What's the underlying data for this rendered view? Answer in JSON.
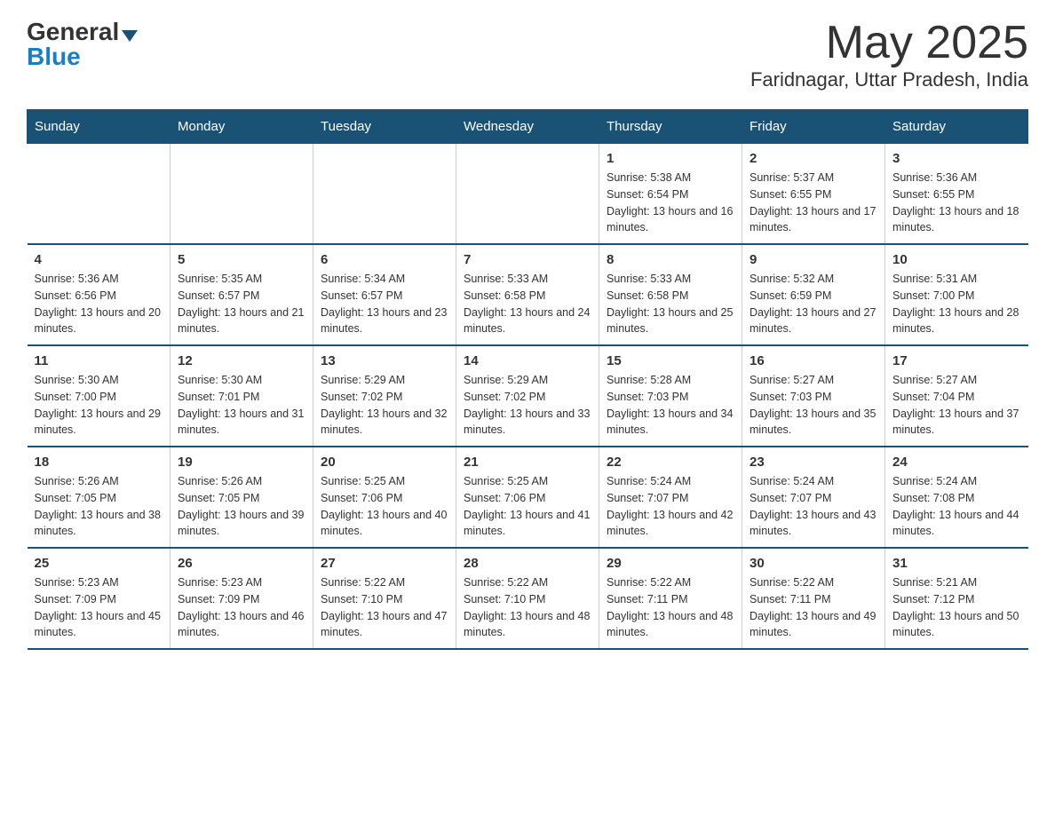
{
  "header": {
    "logo_general": "General",
    "logo_blue": "Blue",
    "month_title": "May 2025",
    "location": "Faridnagar, Uttar Pradesh, India"
  },
  "days_of_week": [
    "Sunday",
    "Monday",
    "Tuesday",
    "Wednesday",
    "Thursday",
    "Friday",
    "Saturday"
  ],
  "weeks": [
    [
      {
        "day": "",
        "info": ""
      },
      {
        "day": "",
        "info": ""
      },
      {
        "day": "",
        "info": ""
      },
      {
        "day": "",
        "info": ""
      },
      {
        "day": "1",
        "info": "Sunrise: 5:38 AM\nSunset: 6:54 PM\nDaylight: 13 hours and 16 minutes."
      },
      {
        "day": "2",
        "info": "Sunrise: 5:37 AM\nSunset: 6:55 PM\nDaylight: 13 hours and 17 minutes."
      },
      {
        "day": "3",
        "info": "Sunrise: 5:36 AM\nSunset: 6:55 PM\nDaylight: 13 hours and 18 minutes."
      }
    ],
    [
      {
        "day": "4",
        "info": "Sunrise: 5:36 AM\nSunset: 6:56 PM\nDaylight: 13 hours and 20 minutes."
      },
      {
        "day": "5",
        "info": "Sunrise: 5:35 AM\nSunset: 6:57 PM\nDaylight: 13 hours and 21 minutes."
      },
      {
        "day": "6",
        "info": "Sunrise: 5:34 AM\nSunset: 6:57 PM\nDaylight: 13 hours and 23 minutes."
      },
      {
        "day": "7",
        "info": "Sunrise: 5:33 AM\nSunset: 6:58 PM\nDaylight: 13 hours and 24 minutes."
      },
      {
        "day": "8",
        "info": "Sunrise: 5:33 AM\nSunset: 6:58 PM\nDaylight: 13 hours and 25 minutes."
      },
      {
        "day": "9",
        "info": "Sunrise: 5:32 AM\nSunset: 6:59 PM\nDaylight: 13 hours and 27 minutes."
      },
      {
        "day": "10",
        "info": "Sunrise: 5:31 AM\nSunset: 7:00 PM\nDaylight: 13 hours and 28 minutes."
      }
    ],
    [
      {
        "day": "11",
        "info": "Sunrise: 5:30 AM\nSunset: 7:00 PM\nDaylight: 13 hours and 29 minutes."
      },
      {
        "day": "12",
        "info": "Sunrise: 5:30 AM\nSunset: 7:01 PM\nDaylight: 13 hours and 31 minutes."
      },
      {
        "day": "13",
        "info": "Sunrise: 5:29 AM\nSunset: 7:02 PM\nDaylight: 13 hours and 32 minutes."
      },
      {
        "day": "14",
        "info": "Sunrise: 5:29 AM\nSunset: 7:02 PM\nDaylight: 13 hours and 33 minutes."
      },
      {
        "day": "15",
        "info": "Sunrise: 5:28 AM\nSunset: 7:03 PM\nDaylight: 13 hours and 34 minutes."
      },
      {
        "day": "16",
        "info": "Sunrise: 5:27 AM\nSunset: 7:03 PM\nDaylight: 13 hours and 35 minutes."
      },
      {
        "day": "17",
        "info": "Sunrise: 5:27 AM\nSunset: 7:04 PM\nDaylight: 13 hours and 37 minutes."
      }
    ],
    [
      {
        "day": "18",
        "info": "Sunrise: 5:26 AM\nSunset: 7:05 PM\nDaylight: 13 hours and 38 minutes."
      },
      {
        "day": "19",
        "info": "Sunrise: 5:26 AM\nSunset: 7:05 PM\nDaylight: 13 hours and 39 minutes."
      },
      {
        "day": "20",
        "info": "Sunrise: 5:25 AM\nSunset: 7:06 PM\nDaylight: 13 hours and 40 minutes."
      },
      {
        "day": "21",
        "info": "Sunrise: 5:25 AM\nSunset: 7:06 PM\nDaylight: 13 hours and 41 minutes."
      },
      {
        "day": "22",
        "info": "Sunrise: 5:24 AM\nSunset: 7:07 PM\nDaylight: 13 hours and 42 minutes."
      },
      {
        "day": "23",
        "info": "Sunrise: 5:24 AM\nSunset: 7:07 PM\nDaylight: 13 hours and 43 minutes."
      },
      {
        "day": "24",
        "info": "Sunrise: 5:24 AM\nSunset: 7:08 PM\nDaylight: 13 hours and 44 minutes."
      }
    ],
    [
      {
        "day": "25",
        "info": "Sunrise: 5:23 AM\nSunset: 7:09 PM\nDaylight: 13 hours and 45 minutes."
      },
      {
        "day": "26",
        "info": "Sunrise: 5:23 AM\nSunset: 7:09 PM\nDaylight: 13 hours and 46 minutes."
      },
      {
        "day": "27",
        "info": "Sunrise: 5:22 AM\nSunset: 7:10 PM\nDaylight: 13 hours and 47 minutes."
      },
      {
        "day": "28",
        "info": "Sunrise: 5:22 AM\nSunset: 7:10 PM\nDaylight: 13 hours and 48 minutes."
      },
      {
        "day": "29",
        "info": "Sunrise: 5:22 AM\nSunset: 7:11 PM\nDaylight: 13 hours and 48 minutes."
      },
      {
        "day": "30",
        "info": "Sunrise: 5:22 AM\nSunset: 7:11 PM\nDaylight: 13 hours and 49 minutes."
      },
      {
        "day": "31",
        "info": "Sunrise: 5:21 AM\nSunset: 7:12 PM\nDaylight: 13 hours and 50 minutes."
      }
    ]
  ]
}
